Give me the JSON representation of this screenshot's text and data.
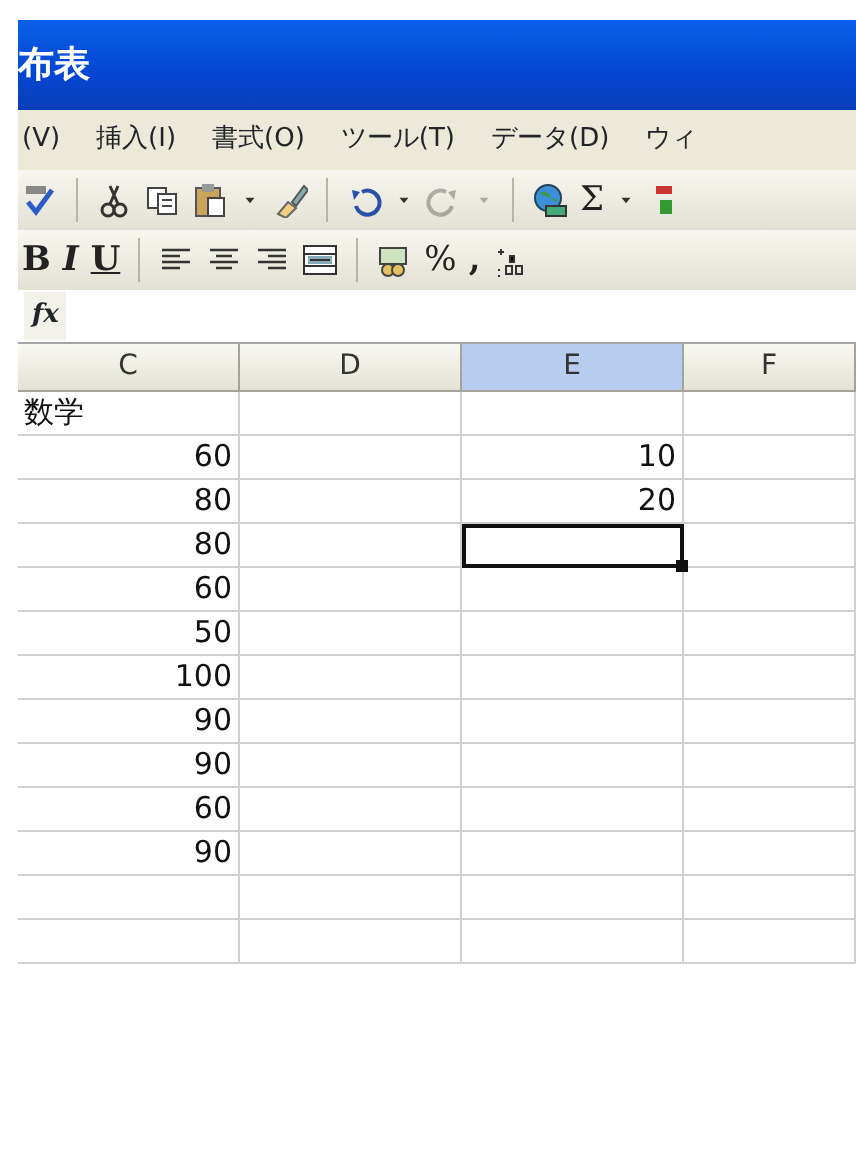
{
  "window": {
    "title": "布表"
  },
  "menu": [
    {
      "label": "(V)"
    },
    {
      "label": "挿入(I)"
    },
    {
      "label": "書式(O)"
    },
    {
      "label": "ツール(T)"
    },
    {
      "label": "データ(D)"
    },
    {
      "label": "ウィ"
    }
  ],
  "toolbar_standard": [
    {
      "kind": "spell"
    },
    {
      "kind": "sep"
    },
    {
      "kind": "cut"
    },
    {
      "kind": "copy"
    },
    {
      "kind": "paste"
    },
    {
      "kind": "caret"
    },
    {
      "kind": "brush"
    },
    {
      "kind": "sep"
    },
    {
      "kind": "undo"
    },
    {
      "kind": "caret"
    },
    {
      "kind": "redo",
      "disabled": true
    },
    {
      "kind": "caret",
      "disabled": true
    },
    {
      "kind": "sep"
    },
    {
      "kind": "globe"
    },
    {
      "kind": "text",
      "label": "Σ"
    },
    {
      "kind": "caret"
    },
    {
      "kind": "sort"
    }
  ],
  "toolbar_format": [
    {
      "kind": "bold",
      "label": "B"
    },
    {
      "kind": "italic",
      "label": "I"
    },
    {
      "kind": "underline",
      "label": "U"
    },
    {
      "kind": "sep"
    },
    {
      "kind": "align-left"
    },
    {
      "kind": "align-center"
    },
    {
      "kind": "align-right"
    },
    {
      "kind": "merge"
    },
    {
      "kind": "sep"
    },
    {
      "kind": "currency"
    },
    {
      "kind": "text",
      "label": "%"
    },
    {
      "kind": "bold",
      "label": ","
    },
    {
      "kind": "decimal"
    }
  ],
  "formula_bar": {
    "label": "fx"
  },
  "columns": [
    {
      "label": "C",
      "selected": false
    },
    {
      "label": "D",
      "selected": false
    },
    {
      "label": "E",
      "selected": true
    },
    {
      "label": "F",
      "selected": false
    }
  ],
  "rows": [
    {
      "kind": "label",
      "c": "数学",
      "e_cell_selected": false
    },
    {
      "kind": "number",
      "c": "60",
      "e": "10",
      "e_cell_selected": false
    },
    {
      "kind": "number",
      "c": "80",
      "e": "20",
      "e_cell_selected": false
    },
    {
      "kind": "number",
      "c": "80",
      "e_cell_selected": true
    },
    {
      "kind": "number",
      "c": "60",
      "e_cell_selected": false
    },
    {
      "kind": "number",
      "c": "50",
      "e_cell_selected": false
    },
    {
      "kind": "number",
      "c": "100",
      "e_cell_selected": false
    },
    {
      "kind": "number",
      "c": "90",
      "e_cell_selected": false
    },
    {
      "kind": "number",
      "c": "90",
      "e_cell_selected": false
    },
    {
      "kind": "number",
      "c": "60",
      "e_cell_selected": false
    },
    {
      "kind": "number",
      "c": "90",
      "e_cell_selected": false
    },
    {
      "e_cell_selected": false
    },
    {
      "e_cell_selected": false
    }
  ]
}
